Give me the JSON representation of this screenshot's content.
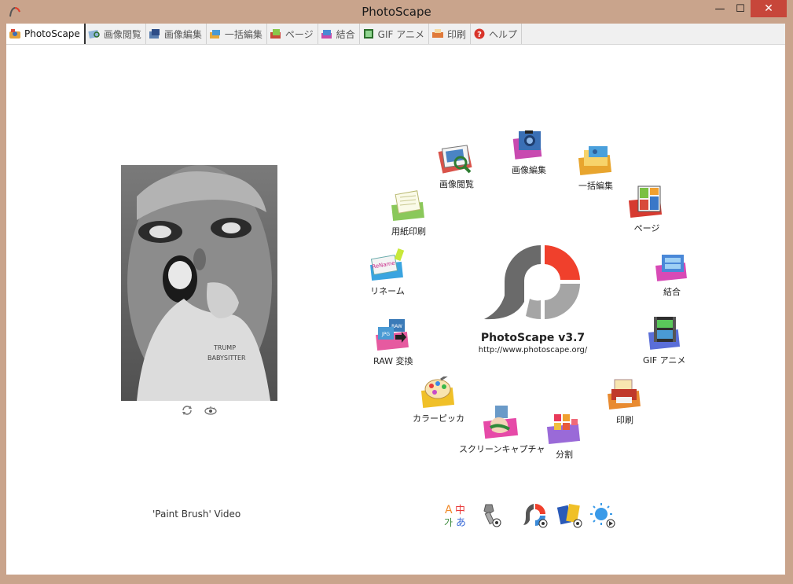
{
  "window": {
    "title": "PhotoScape",
    "minimize_glyph": "—",
    "maximize_glyph": "☐",
    "close_glyph": "✕"
  },
  "tabs": [
    {
      "label": "PhotoScape",
      "icon": "photoscape-tab-icon",
      "active": true
    },
    {
      "label": "画像閲覧",
      "icon": "viewer-tab-icon",
      "active": false
    },
    {
      "label": "画像編集",
      "icon": "editor-tab-icon",
      "active": false
    },
    {
      "label": "一括編集",
      "icon": "batch-tab-icon",
      "active": false
    },
    {
      "label": "ページ",
      "icon": "page-tab-icon",
      "active": false
    },
    {
      "label": "結合",
      "icon": "combine-tab-icon",
      "active": false
    },
    {
      "label": "GIF アニメ",
      "icon": "gif-tab-icon",
      "active": false
    },
    {
      "label": "印刷",
      "icon": "print-tab-icon",
      "active": false
    },
    {
      "label": "ヘルプ",
      "icon": "help-tab-icon",
      "active": false
    }
  ],
  "left_panel": {
    "photo_icon": "inflatable-balloon-photo",
    "caption": "'Paint Brush' Video"
  },
  "menu": {
    "viewer": "画像閲覧",
    "editor": "画像編集",
    "batch": "一括編集",
    "page": "ページ",
    "combine": "結合",
    "gif": "GIF アニメ",
    "print": "印刷",
    "splitter": "分割",
    "screen_capture": "スクリーンキャプチャ",
    "color_picker": "カラーピッカ",
    "raw_convert": "RAW 変換",
    "rename": "リネーム",
    "paper_print": "用紙印刷"
  },
  "brand": {
    "name": "PhotoScape v3.7",
    "url": "http://www.photoscape.org/"
  },
  "colors": {
    "frame": "#c9a48c",
    "logo_red": "#f0402c",
    "logo_gray": "#6a6a6a",
    "logo_light": "#a5a5a5"
  }
}
